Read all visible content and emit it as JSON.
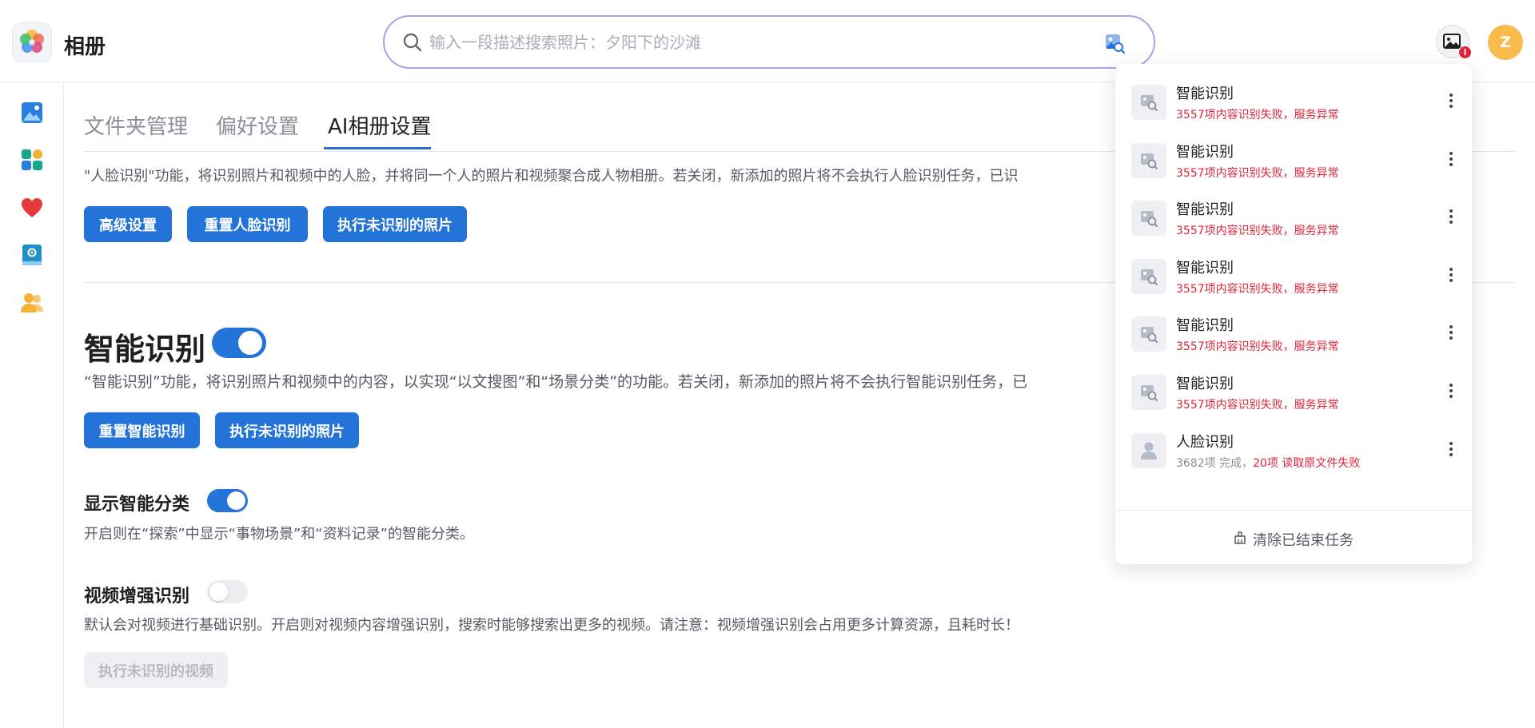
{
  "header": {
    "app_title": "相册",
    "search_placeholder": "输入一段描述搜索照片：夕阳下的沙滩",
    "task_badge": "i",
    "avatar_letter": "Z"
  },
  "sidebar": {
    "items": [
      "photos-icon",
      "albums-icon",
      "favorites-icon",
      "settings-book-icon",
      "people-icon"
    ]
  },
  "tabs": [
    {
      "label": "文件夹管理",
      "active": false
    },
    {
      "label": "偏好设置",
      "active": false
    },
    {
      "label": "AI相册设置",
      "active": true
    }
  ],
  "face_section": {
    "description": "\"人脸识别\"功能，将识别照片和视频中的人脸，并将同一个人的照片和视频聚合成人物相册。若关闭，新添加的照片将不会执行人脸识别任务，已识",
    "buttons": [
      "高级设置",
      "重置人脸识别",
      "执行未识别的照片"
    ]
  },
  "smart_section": {
    "title": "智能识别",
    "enabled": true,
    "description": "“智能识别”功能，将识别照片和视频中的内容，以实现“以文搜图”和“场景分类”的功能。若关闭，新添加的照片将不会执行智能识别任务，已",
    "buttons": [
      "重置智能识别",
      "执行未识别的照片"
    ]
  },
  "classify_section": {
    "title": "显示智能分类",
    "enabled": true,
    "description": "开启则在“探索”中显示“事物场景”和“资料记录”的智能分类。"
  },
  "video_section": {
    "title": "视频增强识别",
    "enabled": false,
    "description": "默认会对视频进行基础识别。开启则对视频内容增强识别，搜索时能够搜索出更多的视频。请注意：视频增强识别会占用更多计算资源，且耗时长！",
    "button": "执行未识别的视频"
  },
  "task_panel": {
    "tasks": [
      {
        "title": "智能识别",
        "status": "3557项内容识别失败，服务异常"
      },
      {
        "title": "智能识别",
        "status": "3557项内容识别失败，服务异常"
      },
      {
        "title": "智能识别",
        "status": "3557项内容识别失败，服务异常"
      },
      {
        "title": "智能识别",
        "status": "3557项内容识别失败，服务异常"
      },
      {
        "title": "智能识别",
        "status": "3557项内容识别失败，服务异常"
      },
      {
        "title": "智能识别",
        "status": "3557项内容识别失败，服务异常"
      }
    ],
    "face_task": {
      "title": "人脸识别",
      "status_grey": "3682项 完成，",
      "status_red": "20项 读取原文件失败"
    },
    "clear_label": "清除已结束任务"
  },
  "colors": {
    "primary": "#2473d9",
    "error": "#e0243a",
    "avatar": "#f8bc4c"
  }
}
